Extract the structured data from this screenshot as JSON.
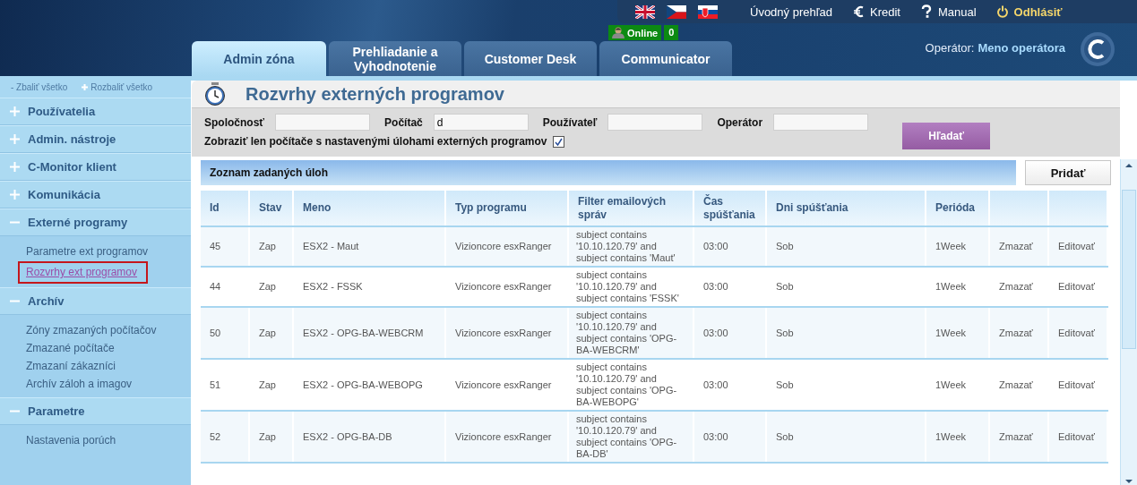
{
  "languages": [
    {
      "kind": "en"
    },
    {
      "kind": "cs"
    },
    {
      "kind": "sk"
    }
  ],
  "top_links": [
    {
      "kind": "home",
      "label": "Úvodný prehľad"
    },
    {
      "kind": "credit",
      "label": "Kredit"
    },
    {
      "kind": "help",
      "label": "Manual"
    },
    {
      "kind": "logout",
      "label": "Odhlásiť"
    }
  ],
  "tabs": [
    {
      "label": "Admin zóna",
      "selected": true
    },
    {
      "label": "Prehliadanie a Vyhodnotenie",
      "selected": false
    },
    {
      "label": "Customer Desk",
      "selected": false
    },
    {
      "label": "Communicator",
      "selected": false,
      "badge": {
        "status": "Online",
        "count": "0"
      }
    }
  ],
  "operator": {
    "label": "Operátor:",
    "name": "Meno operátora"
  },
  "sidebar": {
    "collapse_all": {
      "sign": "-",
      "label": "Zbaliť všetko"
    },
    "expand_all": {
      "label": "Rozbaliť všetko"
    },
    "groups": [
      {
        "label": "Používatelia",
        "expanded": false
      },
      {
        "label": "Admin. nástroje",
        "expanded": false
      },
      {
        "label": "C-Monitor klient",
        "expanded": false
      },
      {
        "label": "Komunikácia",
        "expanded": false
      },
      {
        "label": "Externé programy",
        "expanded": true,
        "children": [
          {
            "label": "Parametre ext programov",
            "selected": false
          },
          {
            "label": "Rozvrhy ext programov",
            "selected": true
          }
        ]
      },
      {
        "label": "Archív",
        "expanded": true,
        "children": [
          {
            "label": "Zóny zmazaných počítačov",
            "selected": false
          },
          {
            "label": "Zmazané počítače",
            "selected": false
          },
          {
            "label": "Zmazaní zákazníci",
            "selected": false
          },
          {
            "label": "Archív záloh a imagov",
            "selected": false
          }
        ]
      },
      {
        "label": "Parametre",
        "expanded": true,
        "children": [
          {
            "label": "Nastavenia porúch",
            "selected": false
          }
        ]
      }
    ]
  },
  "page": {
    "title": "Rozvrhy externých programov"
  },
  "filters": {
    "fields": [
      {
        "label": "Spoločnosť"
      },
      {
        "label": "Počítač",
        "value": "d"
      },
      {
        "label": "Používateľ"
      },
      {
        "label": "Operátor"
      }
    ],
    "checkbox": {
      "label": "Zobraziť len počítače s nastavenými úlohami externých programov",
      "checked": true
    },
    "search_button": "Hľadať"
  },
  "list": {
    "title": "Zoznam zadaných úloh",
    "add_button": "Pridať"
  },
  "table": {
    "columns": [
      "Id",
      "Stav",
      "Meno",
      "Typ programu",
      "Filter emailových správ",
      "Čas spúšťania",
      "Dni spúšťania",
      "Perióda"
    ],
    "rows": [
      {
        "cells": [
          "45",
          "Zap",
          "ESX2 - Maut",
          "Vizioncore esxRanger",
          "subject contains '10.10.120.79' and subject contains 'Maut'",
          "03:00",
          "Sob",
          "1Week"
        ],
        "actions": [
          "Zmazať",
          "Editovať"
        ]
      },
      {
        "cells": [
          "44",
          "Zap",
          "ESX2 - FSSK",
          "Vizioncore esxRanger",
          "subject contains '10.10.120.79' and subject contains 'FSSK'",
          "03:00",
          "Sob",
          "1Week"
        ],
        "actions": [
          "Zmazať",
          "Editovať"
        ]
      },
      {
        "cells": [
          "50",
          "Zap",
          "ESX2 - OPG-BA-WEBCRM",
          "Vizioncore esxRanger",
          "subject contains '10.10.120.79' and subject contains 'OPG-BA-WEBCRM'",
          "03:00",
          "Sob",
          "1Week"
        ],
        "actions": [
          "Zmazať",
          "Editovať"
        ]
      },
      {
        "cells": [
          "51",
          "Zap",
          "ESX2 - OPG-BA-WEBOPG",
          "Vizioncore esxRanger",
          "subject contains '10.10.120.79' and subject contains 'OPG-BA-WEBOPG'",
          "03:00",
          "Sob",
          "1Week"
        ],
        "actions": [
          "Zmazať",
          "Editovať"
        ]
      },
      {
        "cells": [
          "52",
          "Zap",
          "ESX2 - OPG-BA-DB",
          "Vizioncore esxRanger",
          "subject contains '10.10.120.79' and subject contains 'OPG-BA-DB'",
          "03:00",
          "Sob",
          "1Week"
        ],
        "actions": [
          "Zmazať",
          "Editovať"
        ]
      }
    ]
  }
}
